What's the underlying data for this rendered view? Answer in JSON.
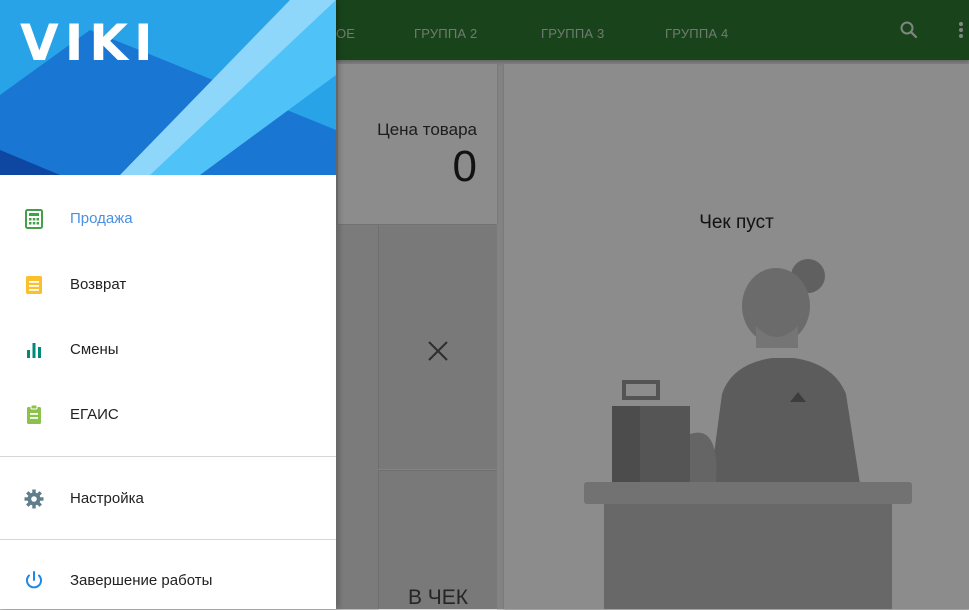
{
  "drawer": {
    "logo": "VIKI",
    "items": [
      {
        "label": "Продажа",
        "icon": "calculator-icon",
        "color": "#43a047",
        "active": true
      },
      {
        "label": "Возврат",
        "icon": "note-icon",
        "color": "#fbc02d"
      },
      {
        "label": "Смены",
        "icon": "bar-chart-icon",
        "color": "#00897b"
      },
      {
        "label": "ЕГАИС",
        "icon": "clipboard-icon",
        "color": "#8bc34a"
      }
    ],
    "settings": {
      "label": "Настройка",
      "icon": "gear-icon"
    },
    "exit": {
      "label": "Завершение работы",
      "icon": "power-icon"
    }
  },
  "topbar": {
    "tabs": [
      "ОЕ",
      "ГРУППА 2",
      "ГРУППА 3",
      "ГРУППА 4"
    ],
    "icons": [
      "search-icon",
      "more-vert-icon"
    ],
    "color": "#2e7d32"
  },
  "price": {
    "label": "Цена товара",
    "value": "0"
  },
  "buttons": {
    "clear_icon": "close-icon",
    "add_label": "В ЧЕК"
  },
  "receipt": {
    "title": "Чек пуст"
  },
  "colors": {
    "accent": "#4a90e2",
    "header_blue": "#1e88e5"
  }
}
